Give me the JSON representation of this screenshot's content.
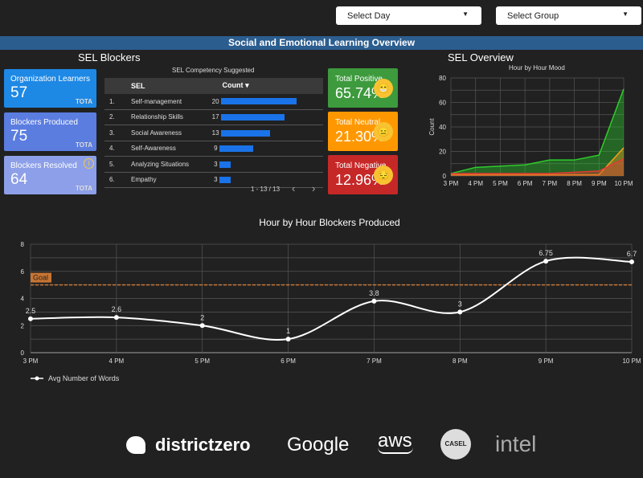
{
  "filters": {
    "day": "Select Day",
    "group": "Select Group"
  },
  "header": {
    "title": "Social and Emotional Learning Overview"
  },
  "blockers": {
    "title": "SEL Blockers",
    "cards": [
      {
        "label": "Organization Learners",
        "value": "57",
        "suffix": "TOTA",
        "color": "#1e88e5"
      },
      {
        "label": "Blockers Produced",
        "value": "75",
        "suffix": "TOTA",
        "color": "#5b7de0"
      },
      {
        "label": "Blockers Resolved",
        "value": "64",
        "suffix": "TOTA",
        "color": "#8c9fe8"
      }
    ]
  },
  "table": {
    "title": "SEL Competency Suggested",
    "col_sel": "SEL",
    "col_count": "Count",
    "sort_icon": "▾",
    "rows": [
      {
        "n": "1.",
        "sel": "Self-management",
        "count": 20
      },
      {
        "n": "2.",
        "sel": "Relationship Skills",
        "count": 17
      },
      {
        "n": "3.",
        "sel": "Social Awareness",
        "count": 13
      },
      {
        "n": "4.",
        "sel": "Self-Awareness",
        "count": 9
      },
      {
        "n": "5.",
        "sel": "Analyzing Situations",
        "count": 3
      },
      {
        "n": "6.",
        "sel": "Empathy",
        "count": 3
      }
    ],
    "pagination": "1 - 13 / 13",
    "prev": "‹",
    "next": "›"
  },
  "overview": {
    "title": "SEL Overview",
    "cards": [
      {
        "label": "Total Positive",
        "value": "65.74%",
        "color": "#3d9a3d",
        "emoji": "grinning-face-icon",
        "glyph": "😁"
      },
      {
        "label": "Total Neutral",
        "value": "21.30%",
        "color": "#ff9800",
        "emoji": "expressionless-face-icon",
        "glyph": "😑"
      },
      {
        "label": "Total Negative",
        "value": "12.96%",
        "color": "#c62828",
        "emoji": "pensive-face-icon",
        "glyph": "😔"
      }
    ]
  },
  "chart_data": [
    {
      "type": "area",
      "title": "Hour by Hour Mood",
      "ylabel": "Count",
      "xlabel": "",
      "categories": [
        "3 PM",
        "4 PM",
        "5 PM",
        "6 PM",
        "7 PM",
        "8 PM",
        "9 PM",
        "10 PM"
      ],
      "ylim": [
        0,
        80
      ],
      "yticks": [
        0,
        20,
        40,
        60,
        80
      ],
      "grid": true,
      "series": [
        {
          "values": [
            2,
            7,
            8,
            9,
            13,
            13,
            17,
            71
          ],
          "color": "#2ecc2e"
        },
        {
          "values": [
            1,
            1,
            1,
            1,
            1,
            1,
            1,
            23
          ],
          "color": "#f0a020"
        },
        {
          "values": [
            2,
            2,
            2,
            2,
            2,
            3,
            4,
            14
          ],
          "color": "#e53935"
        }
      ]
    },
    {
      "type": "line",
      "title": "Hour by Hour Blockers Produced",
      "categories": [
        "3 PM",
        "4 PM",
        "5 PM",
        "6 PM",
        "7 PM",
        "8 PM",
        "9 PM",
        "10 PM"
      ],
      "ylim": [
        0,
        8
      ],
      "yticks": [
        0,
        2,
        4,
        6,
        8
      ],
      "grid": true,
      "legend": "bottom-left",
      "series": [
        {
          "name": "Avg Number of Words",
          "values": [
            2.5,
            2.6,
            2,
            1,
            3.8,
            3,
            6.75,
            6.7
          ],
          "labels": [
            "2.5",
            "2.6",
            "2",
            "1",
            "3.8",
            "3",
            "6.75",
            "6.7"
          ],
          "color": "#ffffff"
        }
      ],
      "goal": {
        "label": "Goal",
        "value": 5,
        "color": "#c87533"
      }
    }
  ],
  "logos": [
    "districtzero",
    "Google",
    "aws",
    "CASEL",
    "intel"
  ]
}
